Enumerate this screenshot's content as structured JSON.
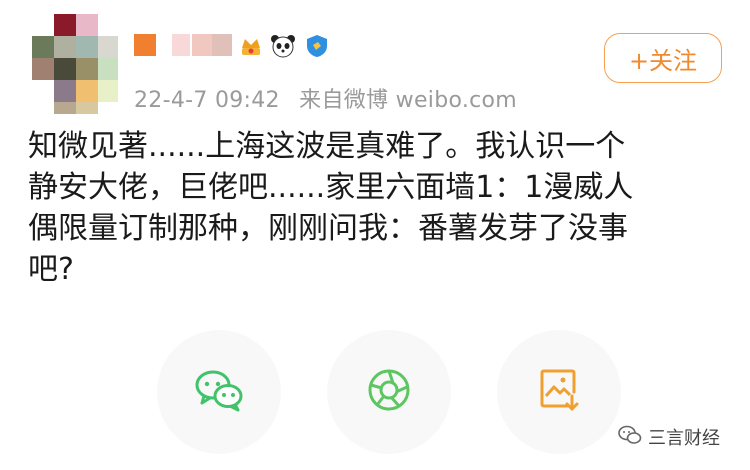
{
  "post_header": {
    "meta": {
      "timestamp": "22-4-7 09:42",
      "source": "来自微博 weibo.com"
    },
    "follow_label": "+关注",
    "badges": [
      "crown-icon",
      "panda-icon",
      "shield-icon"
    ]
  },
  "post": {
    "lines": [
      "知微见著......上海这波是真难了。我认识一个",
      "静安大佬，巨佬吧......家里六面墙1：1漫威人",
      "偶限量订制那种，刚刚问我：番薯发芽了没事",
      "吧?"
    ]
  },
  "actions": [
    {
      "name": "wechat-share",
      "icon": "wechat-icon",
      "color": "#43c26c"
    },
    {
      "name": "moments-share",
      "icon": "moments-icon",
      "color": "#5cc660"
    },
    {
      "name": "save-image",
      "icon": "save-image-icon",
      "color": "#f0a030"
    }
  ],
  "watermark": {
    "text": "三言财经"
  }
}
